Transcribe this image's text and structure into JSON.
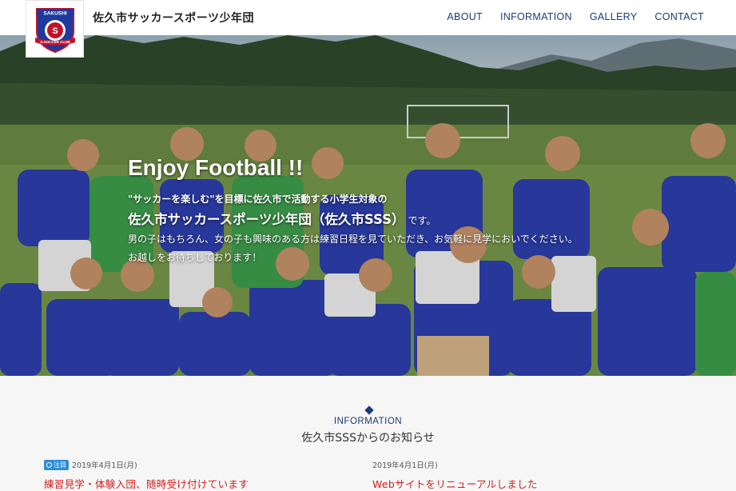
{
  "header": {
    "title": "佐久市サッカースポーツ少年団",
    "logo": {
      "top_text": "SAKUSHI",
      "number": "S",
      "bottom_text": "S.SOCCER CLUB"
    },
    "nav": [
      {
        "label": "ABOUT"
      },
      {
        "label": "INFORMATION"
      },
      {
        "label": "GALLERY"
      },
      {
        "label": "CONTACT"
      }
    ]
  },
  "hero": {
    "heading": "Enjoy Football !!",
    "line1": "\"サッカーを楽しむ\"を目標に佐久市で活動する小学生対象の",
    "line2_main": "佐久市サッカースポーツ少年団（佐久市SSS）",
    "line2_tail": "です。",
    "line3": "男の子はもちろん、女の子も興味のある方は練習日程を見ていただき、お気軽に見学においでください。",
    "line4": "お越しをお待ちしております！"
  },
  "information": {
    "label": "INFORMATION",
    "title": "佐久市SSSからのお知らせ",
    "items": [
      {
        "badge": "注目",
        "date": "2019年4月1日(月)",
        "title": "練習見学・体験入団、随時受け付けています"
      },
      {
        "date": "2019年4月1日(月)",
        "title": "Webサイトをリニューアルしました"
      }
    ]
  },
  "colors": {
    "accent": "#1d3a7a",
    "news_title": "#d0201b",
    "badge": "#2f8ed8"
  }
}
